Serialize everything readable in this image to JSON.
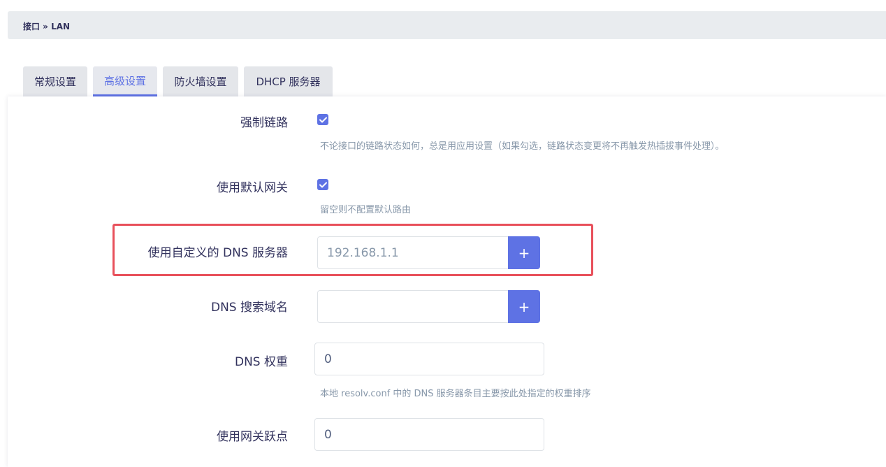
{
  "breadcrumb": "接口 » LAN",
  "tabs": [
    {
      "label": "常规设置"
    },
    {
      "label": "高级设置"
    },
    {
      "label": "防火墙设置"
    },
    {
      "label": "DHCP 服务器"
    }
  ],
  "active_tab": "高级设置",
  "fields": {
    "force_link": {
      "label": "强制链路",
      "checked": true,
      "help": "不论接口的链路状态如何，总是用应用设置（如果勾选，链路状态变更将不再触发热插拔事件处理）。"
    },
    "default_gateway": {
      "label": "使用默认网关",
      "checked": true,
      "help": "留空则不配置默认路由"
    },
    "custom_dns": {
      "label": "使用自定义的 DNS 服务器",
      "value": "192.168.1.1",
      "add_label": "+"
    },
    "dns_search": {
      "label": "DNS 搜索域名",
      "value": "",
      "add_label": "+"
    },
    "dns_weight": {
      "label": "DNS 权重",
      "value": "0",
      "help": "本地 resolv.conf 中的 DNS 服务器条目主要按此处指定的权重排序"
    },
    "gateway_metric": {
      "label": "使用网关跃点",
      "value": "0"
    }
  },
  "colors": {
    "accent": "#5e72e4",
    "highlight": "#e8505b",
    "text": "#32325d",
    "muted": "#8898aa"
  }
}
